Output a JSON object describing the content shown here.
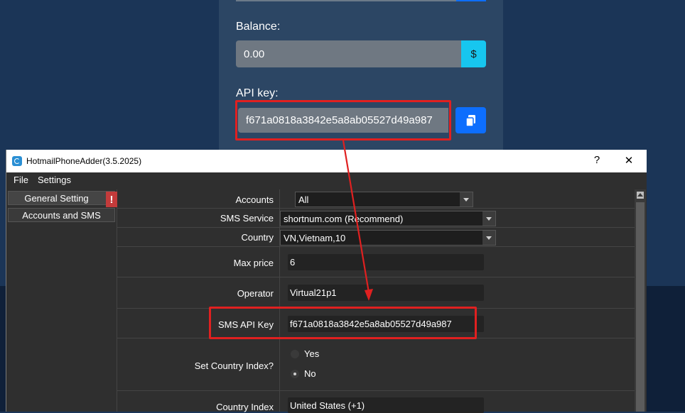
{
  "web": {
    "balance_label": "Balance:",
    "balance_value": "0.00",
    "currency_symbol": "$",
    "api_key_label": "API key:",
    "api_key_value": "f671a0818a3842e5a8ab05527d49a987",
    "copy_icon": "copy-icon"
  },
  "window": {
    "title": "HotmailPhoneAdder(3.5.2025)",
    "help_label": "?",
    "close_label": "✕"
  },
  "menu": {
    "file": "File",
    "settings": "Settings"
  },
  "sidebar": {
    "items": [
      {
        "label": "General Setting",
        "badge": "!"
      },
      {
        "label": "Accounts and SMS"
      }
    ]
  },
  "form": {
    "accounts_label": "Accounts",
    "accounts_value": "All",
    "sms_service_label": "SMS Service",
    "sms_service_value": "shortnum.com (Recommend)",
    "country_label": "Country",
    "country_value": "VN,Vietnam,10",
    "max_price_label": "Max price",
    "max_price_value": "6",
    "operator_label": "Operator",
    "operator_value": "Virtual21p1",
    "sms_api_key_label": "SMS API Key",
    "sms_api_key_value": "f671a0818a3842e5a8ab05527d49a987",
    "set_country_index_label": "Set Country Index?",
    "option_yes": "Yes",
    "option_no": "No",
    "country_index_label": "Country Index",
    "country_index_value": "United States (+1)"
  },
  "colors": {
    "highlight": "#e02020",
    "primary_button": "#0d6efd",
    "info_button": "#17c6ef",
    "warning_badge": "#c33b3b"
  }
}
